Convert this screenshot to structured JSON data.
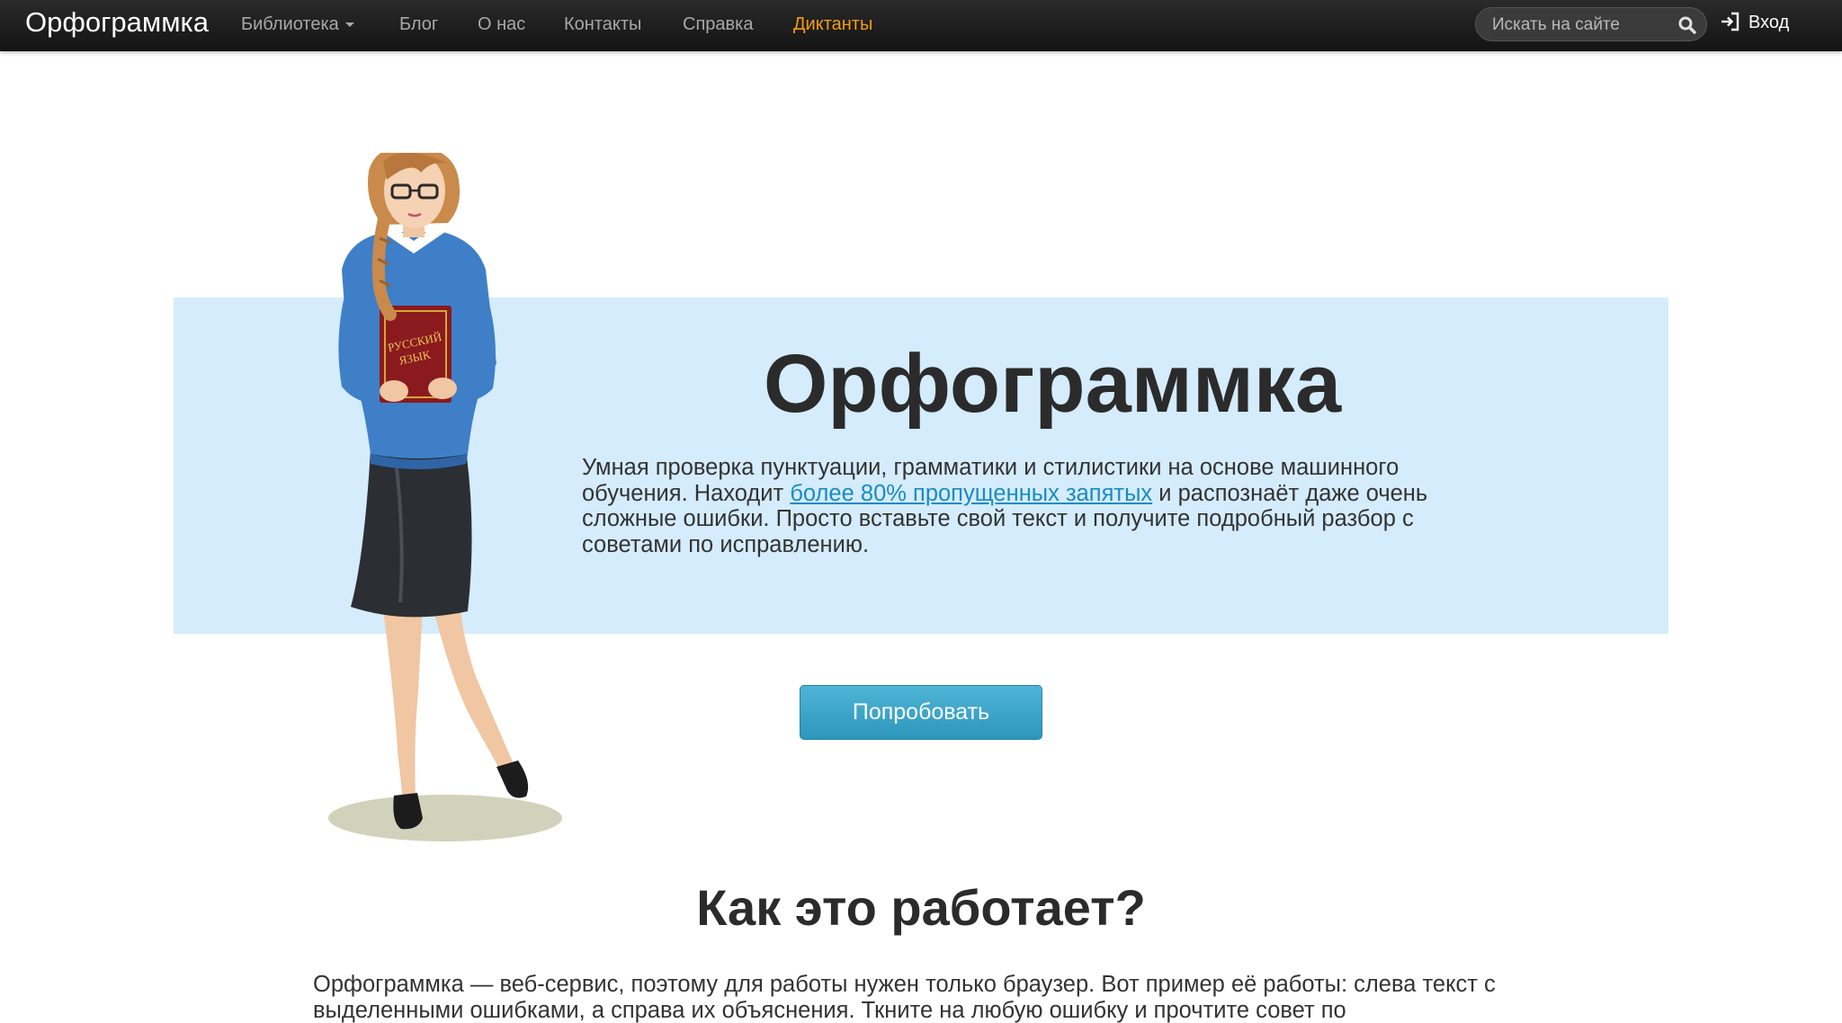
{
  "navbar": {
    "brand": "Орфограммка",
    "items": [
      {
        "label": "Библиотека",
        "dropdown": true
      },
      {
        "label": "Блог"
      },
      {
        "label": "О нас"
      },
      {
        "label": "Контакты"
      },
      {
        "label": "Справка"
      },
      {
        "label": "Диктанты",
        "active": true
      }
    ],
    "search_placeholder": "Искать на сайте",
    "search_icon": "search-icon",
    "login_icon": "sign-in-icon",
    "login_label": "Вход",
    "accent_color": "#f39c12"
  },
  "hero": {
    "title": "Орфограммка",
    "text_before": "Умная проверка пунктуации, грамматики и стилистики на основе машинного обучения. Находит ",
    "link": "более 80% пропущенных запятых",
    "text_after": " и распознаёт даже очень сложные ошибки. Просто вставьте свой текст и получите подробный разбор с советами по исправлению.",
    "button": "Попробовать",
    "book_label_line1": "РУССКИЙ",
    "book_label_line2": "ЯЗЫК",
    "band_color": "#d4ecfc"
  },
  "how": {
    "title": "Как это работает?",
    "text": "Орфограммка — веб-сервис, поэтому для работы нужен только браузер. Вот пример её работы: слева текст с выделенными ошибками, а справа их объяснения. Ткните на любую ошибку и прочтите совет по"
  }
}
